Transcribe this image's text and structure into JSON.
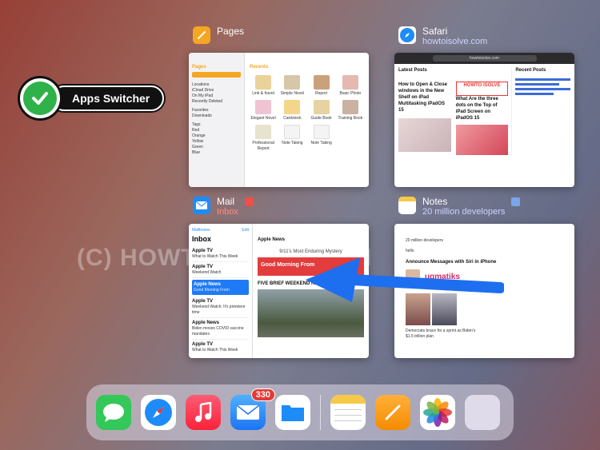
{
  "badge": {
    "label": "Apps Switcher"
  },
  "watermark": "(C) HOWTOISOLVE.COM",
  "pages": {
    "name": "Pages",
    "sidebar_title": "Pages",
    "recents_label": "Recents",
    "sidebar_items": [
      "Locations",
      "iCloud Drive",
      "On My iPad",
      "Recently Deleted",
      "Favorites",
      "Downloads",
      "Tags",
      "Red",
      "Orange",
      "Yellow",
      "Green",
      "Blue"
    ],
    "docs": [
      "Link & found",
      "Simple Novel",
      "Report",
      "Basic Photo",
      "Elegant Novel",
      "Cardstock",
      "Guide Book",
      "Training Book",
      "Professional Report",
      "Note Taking",
      "Note Taking"
    ]
  },
  "safari": {
    "name": "Safari",
    "subtitle": "howtoisolve.com",
    "url": "howtoisolve.com",
    "latest_posts": "Latest Posts",
    "recent_posts": "Recent Posts",
    "post1": "How to Open & Close windows in the New Shelf on iPad Multitasking iPadOS 15",
    "post2": "What Are the three dots on the Top of iPad Screen on iPadOS 15",
    "logo": "HOWTO ISOLVE"
  },
  "mail": {
    "name": "Mail",
    "subtitle": "Inbox",
    "back_label": "Mailboxes",
    "edit_label": "Edit",
    "inbox_label": "Inbox",
    "messages": [
      {
        "from": "Apple TV",
        "subject": "What to Watch This Week"
      },
      {
        "from": "Apple TV",
        "subject": "Weekend Watch"
      },
      {
        "from": "Apple News",
        "subject": "Good Morning From"
      },
      {
        "from": "Apple TV",
        "subject": "Weekend Watch: It's premiere time"
      },
      {
        "from": "Apple News",
        "subject": "Biden moves COVID vaccine mandates"
      },
      {
        "from": "Apple TV",
        "subject": "What to Watch This Week"
      }
    ],
    "open_from": "Apple News",
    "headline": "9/11's Most Enduring Mystery",
    "banner": "Good Morning From",
    "weekend": "FIVE BRIEF WEEKEND READS"
  },
  "notes": {
    "name": "Notes",
    "subtitle": "20 million developers",
    "line1": "20 million developers",
    "line2": "hello",
    "line3": "Announce Messages with Siri in iPhone",
    "brand": "ugmatiks",
    "caption": "Democrats brace for a sprint as Biden's $1.5 trillion plan"
  },
  "dock": {
    "mail_badge": "330",
    "apps": [
      "messages-icon",
      "safari-icon",
      "music-icon",
      "mail-icon",
      "files-icon",
      "notes-icon",
      "pages-icon",
      "photos-icon",
      "app-library-icon"
    ]
  },
  "colors": {
    "accent_orange": "#f5a623",
    "safari_blue": "#1d8cf8",
    "selection_blue": "#1f7af5",
    "arrow_blue": "#1e6ef0",
    "check_green": "#2fb24a"
  }
}
